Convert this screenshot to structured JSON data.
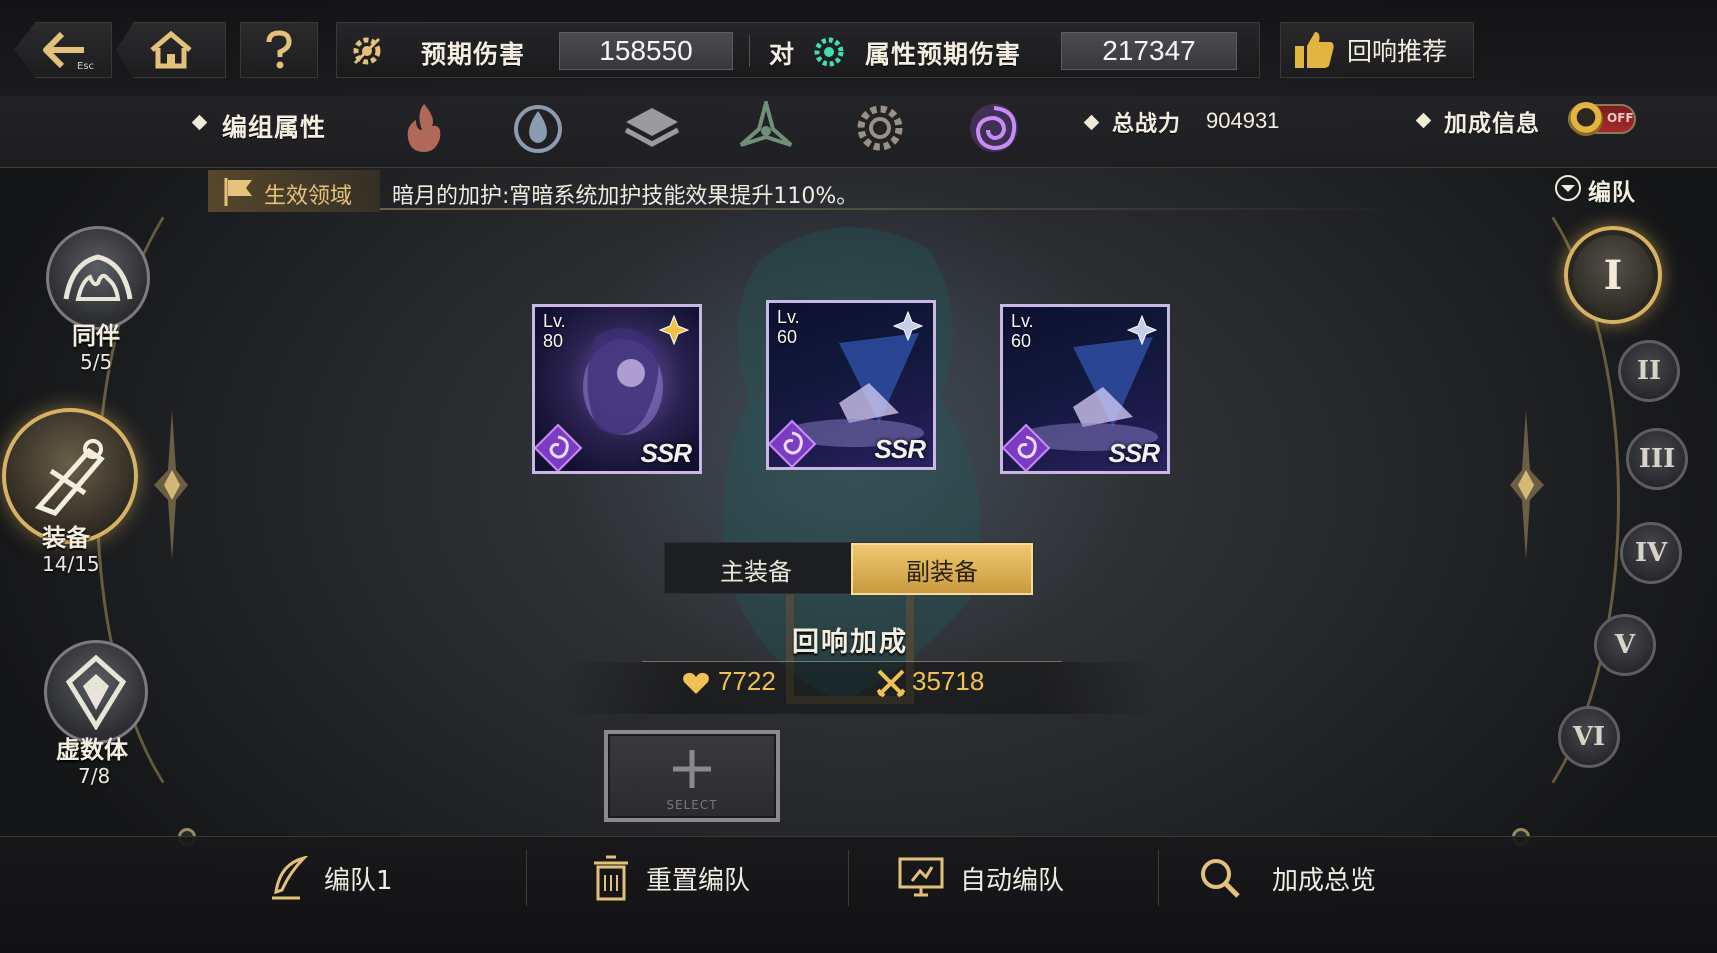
{
  "top": {
    "esc_label": "Esc",
    "expected_damage_label": "预期伤害",
    "expected_damage_value": "158550",
    "vs_label": "对",
    "attr_damage_label": "属性预期伤害",
    "attr_damage_value": "217347",
    "recommend_label": "回响推荐"
  },
  "attributes": {
    "group_label": "编组属性",
    "elements": [
      "fire-icon",
      "water-icon",
      "wind-icon",
      "thunder-icon",
      "light-icon",
      "dark-icon"
    ],
    "power_label": "总战力",
    "power_value": "904931",
    "bonus_label": "加成信息",
    "toggle_state": "OFF"
  },
  "effect": {
    "tag": "生效领域",
    "text": "暗月的加护:宵暗系统加护技能效果提升110%。"
  },
  "left_nav": [
    {
      "label": "同伴",
      "count": "5/5"
    },
    {
      "label": "装备",
      "count": "14/15"
    },
    {
      "label": "虚数体",
      "count": "7/8"
    }
  ],
  "squad": {
    "label": "编队",
    "buttons": [
      "I",
      "II",
      "III",
      "IV",
      "V",
      "VI"
    ],
    "active": "I"
  },
  "cards": [
    {
      "lv_label": "Lv.",
      "level": "80",
      "rarity": "SSR"
    },
    {
      "lv_label": "Lv.",
      "level": "60",
      "rarity": "SSR"
    },
    {
      "lv_label": "Lv.",
      "level": "60",
      "rarity": "SSR"
    }
  ],
  "tabs": {
    "main": "主装备",
    "sub": "副装备",
    "active": "sub"
  },
  "echo": {
    "title": "回响加成",
    "hp_value": "7722",
    "atk_value": "35718"
  },
  "select_slot": {
    "label": "SELECT"
  },
  "bottom": {
    "squad_name": "编队1",
    "reset": "重置编队",
    "auto": "自动编队",
    "overview": "加成总览"
  },
  "colors": {
    "accent_gold": "#d7b265",
    "value_gold": "#f2c154",
    "card_border": "#c9b8e6",
    "dark_element": "#9a5de0"
  }
}
